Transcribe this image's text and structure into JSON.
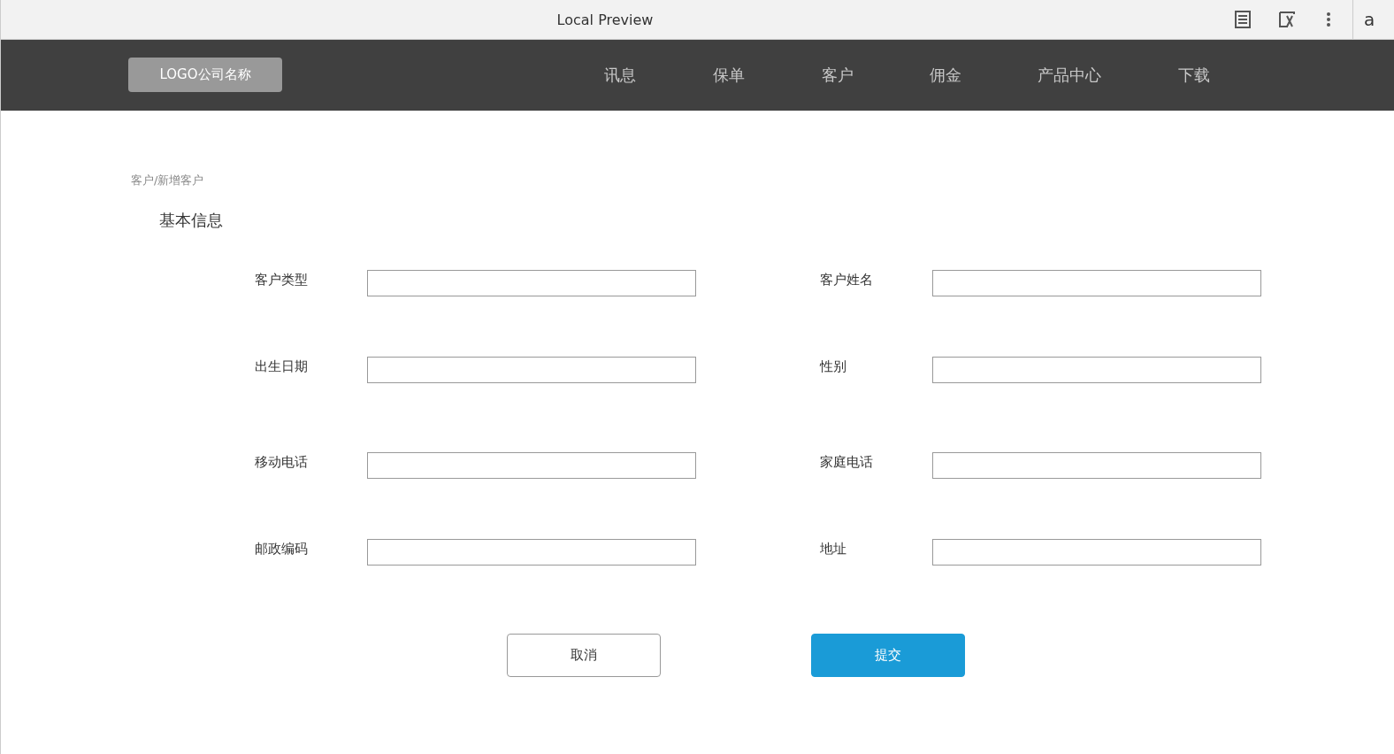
{
  "window": {
    "title": "Local Preview",
    "edge_text": "a"
  },
  "navbar": {
    "logo": "LOGO公司名称",
    "items": [
      {
        "label": "讯息"
      },
      {
        "label": "保单"
      },
      {
        "label": "客户"
      },
      {
        "label": "佣金"
      },
      {
        "label": "产品中心"
      },
      {
        "label": "下载"
      }
    ]
  },
  "breadcrumb": "客户/新增客户",
  "section_title": "基本信息",
  "form": {
    "rows": [
      {
        "fields": [
          {
            "label": "客户类型"
          },
          {
            "label": "客户姓名"
          }
        ]
      },
      {
        "fields": [
          {
            "label": "出生日期"
          },
          {
            "label": "性别"
          }
        ]
      },
      {
        "fields": [
          {
            "label": "移动电话"
          },
          {
            "label": "家庭电话"
          }
        ]
      },
      {
        "fields": [
          {
            "label": "邮政编码"
          },
          {
            "label": "地址"
          }
        ]
      }
    ]
  },
  "buttons": [
    {
      "label": "取消",
      "kind": "secondary"
    },
    {
      "label": "提交",
      "kind": "primary"
    }
  ]
}
